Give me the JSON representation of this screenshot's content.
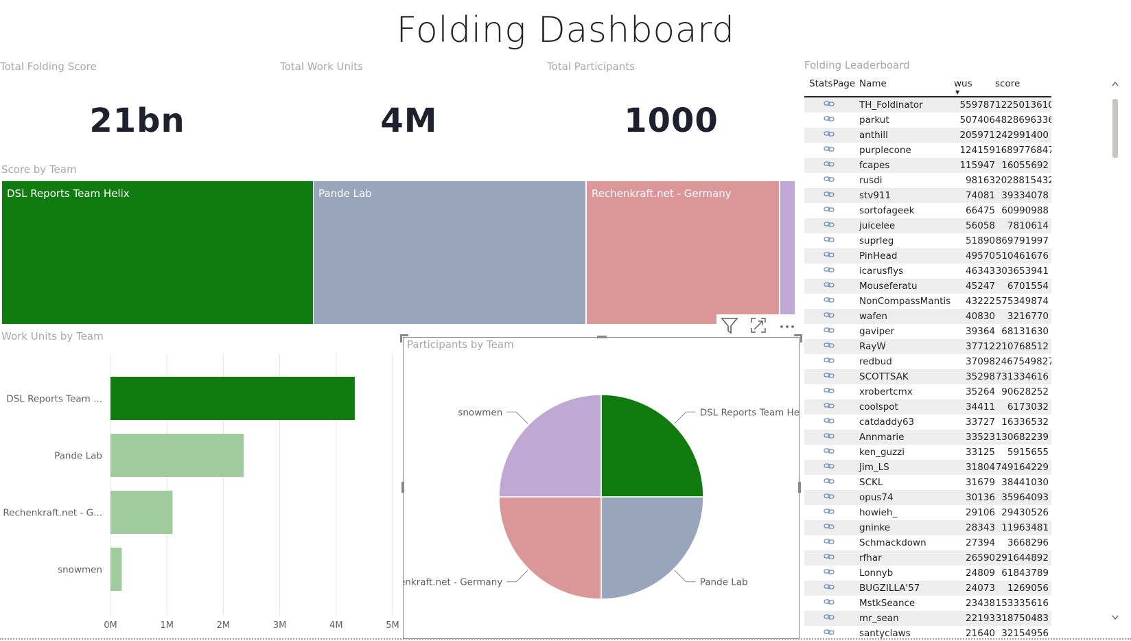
{
  "page": {
    "title": "Folding Dashboard"
  },
  "cards": [
    {
      "title": "Total Folding Score",
      "value": "21bn"
    },
    {
      "title": "Total Work Units",
      "value": "4M"
    },
    {
      "title": "Total Participants",
      "value": "1000"
    }
  ],
  "colors": {
    "helix": "#107c10",
    "pande": "#99a5ba",
    "rechen": "#db9697",
    "snowmen": "#bfa8d3",
    "bar_light": "#9fcb9d"
  },
  "treemap": {
    "title": "Score by Team",
    "cells": [
      {
        "label": "DSL Reports Team Helix",
        "color": "#107c10"
      },
      {
        "label": "Pande Lab",
        "color": "#99a5ba"
      },
      {
        "label": "Rechenkraft.net - Germany",
        "color": "#db9697"
      },
      {
        "label": "",
        "color": "#bfa8d3"
      }
    ]
  },
  "visual_header": {
    "icons": [
      "filter-icon",
      "focus-mode-icon",
      "more-options-icon"
    ]
  },
  "work_units_chart": {
    "title": "Work Units by Team",
    "chart_data": {
      "type": "bar",
      "orientation": "horizontal",
      "categories": [
        "DSL Reports Team ...",
        "Pande Lab",
        "Rechenkraft.net - G...",
        "snowmen"
      ],
      "values": [
        4.33,
        2.36,
        1.1,
        0.2
      ],
      "unit": "M",
      "xlim": [
        0,
        5
      ],
      "xticks": [
        "0M",
        "1M",
        "2M",
        "3M",
        "4M",
        "5M"
      ],
      "grid": true,
      "colors": [
        "#107c10",
        "#9fcb9d",
        "#9fcb9d",
        "#9fcb9d"
      ]
    }
  },
  "participants_chart": {
    "title": "Participants by Team",
    "chart_data": {
      "type": "pie",
      "slices": [
        {
          "label": "DSL Reports Team Helix",
          "value": 250,
          "color": "#107c10"
        },
        {
          "label": "Pande Lab",
          "value": 250,
          "color": "#99a5ba"
        },
        {
          "label": "Rechenkraft.net - Germany",
          "value": 250,
          "color": "#db9697"
        },
        {
          "label": "snowmen",
          "value": 250,
          "color": "#bfa8d3"
        }
      ]
    }
  },
  "leaderboard": {
    "title": "Folding Leaderboard",
    "columns": [
      "StatsPage",
      "Name",
      "wus",
      "score"
    ],
    "sorted_column": "wus",
    "link_icon": "link-icon",
    "rows": [
      [
        "TH_Foldinator",
        "559787",
        "1225013610"
      ],
      [
        "parkut",
        "507406",
        "4828696336"
      ],
      [
        "anthill",
        "205971",
        "242991400"
      ],
      [
        "purplecone",
        "124159",
        "1689776847"
      ],
      [
        "fcapes",
        "115947",
        "16055692"
      ],
      [
        "rusdi",
        "98163",
        "2028815432"
      ],
      [
        "stv911",
        "74081",
        "39334078"
      ],
      [
        "sortofageek",
        "66475",
        "60990988"
      ],
      [
        "juicelee",
        "56058",
        "7810614"
      ],
      [
        "suprleg",
        "51890",
        "869791997"
      ],
      [
        "PinHead",
        "49570",
        "510461676"
      ],
      [
        "icarusflys",
        "46343",
        "303653941"
      ],
      [
        "Mouseferatu",
        "45247",
        "6701554"
      ],
      [
        "NonCompassMantis",
        "43222",
        "575349874"
      ],
      [
        "wafen",
        "40830",
        "3216770"
      ],
      [
        "gaviper",
        "39364",
        "68131630"
      ],
      [
        "RayW",
        "37712",
        "210768512"
      ],
      [
        "redbud",
        "37098",
        "2467549827"
      ],
      [
        "SCOTTSAK",
        "35298",
        "731334616"
      ],
      [
        "xrobertcmx",
        "35264",
        "90628252"
      ],
      [
        "coolspot",
        "34411",
        "6173032"
      ],
      [
        "catdaddy63",
        "33727",
        "16336532"
      ],
      [
        "Annmarie",
        "33523",
        "130682239"
      ],
      [
        "ken_guzzi",
        "33125",
        "5915655"
      ],
      [
        "Jim_LS",
        "31804",
        "749164229"
      ],
      [
        "SCKL",
        "31679",
        "38441030"
      ],
      [
        "opus74",
        "30136",
        "35964093"
      ],
      [
        "howieh_",
        "29106",
        "29430526"
      ],
      [
        "gninke",
        "28343",
        "11963481"
      ],
      [
        "Schmackdown",
        "27394",
        "3668296"
      ],
      [
        "rfhar",
        "26590",
        "291644892"
      ],
      [
        "Lonnyb",
        "24809",
        "61843789"
      ],
      [
        "BUGZILLA'57",
        "24073",
        "1269056"
      ],
      [
        "MstkSeance",
        "23438",
        "153335616"
      ],
      [
        "mr_sean",
        "22193",
        "318750483"
      ],
      [
        "santyclaws",
        "21640",
        "32154956"
      ]
    ]
  }
}
